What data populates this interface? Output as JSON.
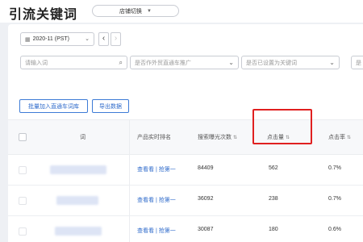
{
  "header": {
    "title": "引流关键词",
    "store_switch_label": "店铺切换"
  },
  "toolbar": {
    "date_value": "2020-11 (PST)",
    "prev_label": "‹",
    "next_label": "›"
  },
  "filters": {
    "keyword_placeholder": "请输入词",
    "promoted_placeholder": "是否作外贸直通车推广",
    "set_keyword_placeholder": "是否已设置为关键词",
    "extra_placeholder": "是"
  },
  "actions": {
    "batch_add_label": "批量加入直通车词库",
    "export_label": "导出数据"
  },
  "table": {
    "columns": {
      "word": "词",
      "rank": "产品实时排名",
      "exposure": "搜索曝光次数",
      "clicks": "点击量",
      "ctr": "点击率"
    },
    "rows": [
      {
        "rank_link": "查看看 | 抢第一",
        "exposure": "84409",
        "clicks": "562",
        "ctr": "0.7%"
      },
      {
        "rank_link": "查看看 | 抢第一",
        "exposure": "36092",
        "clicks": "238",
        "ctr": "0.7%"
      },
      {
        "rank_link": "查看看 | 抢第一",
        "exposure": "30087",
        "clicks": "180",
        "ctr": "0.6%"
      }
    ]
  },
  "icons": {
    "sort": "⇅",
    "search": "⌕",
    "caret": "⌄"
  },
  "colors": {
    "accent": "#2f6bcb",
    "highlight": "#e02020",
    "background": "#eef0f4"
  }
}
